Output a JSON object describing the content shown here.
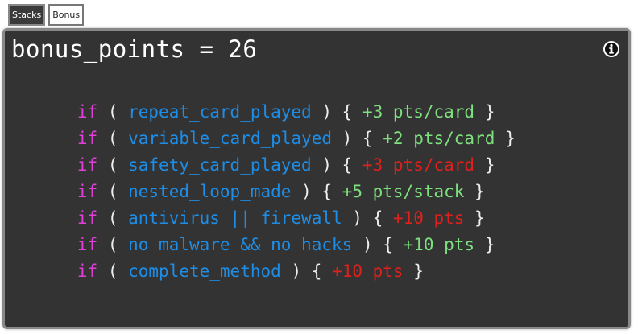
{
  "tabs": [
    {
      "label": "Stacks",
      "active": true
    },
    {
      "label": "Bonus",
      "active": false
    }
  ],
  "panel": {
    "title": "bonus_points = 26",
    "info_icon": "info-circle-icon"
  },
  "rules": [
    {
      "keyword": "if",
      "open": "(",
      "condition": "repeat_card_played",
      "close": ")",
      "brace_open": "{",
      "points": "+3 pts/card",
      "brace_close": "}",
      "color": "#7ee07e"
    },
    {
      "keyword": "if",
      "open": "(",
      "condition": "variable_card_played",
      "close": ")",
      "brace_open": "{",
      "points": "+2 pts/card",
      "brace_close": "}",
      "color": "#7ee07e"
    },
    {
      "keyword": "if",
      "open": "(",
      "condition": "safety_card_played",
      "close": ")",
      "brace_open": "{",
      "points": "+3 pts/card",
      "brace_close": "}",
      "color": "#e0201c"
    },
    {
      "keyword": "if",
      "open": "(",
      "condition": "nested_loop_made",
      "close": ")",
      "brace_open": "{",
      "points": "+5 pts/stack",
      "brace_close": "}",
      "color": "#7ee07e"
    },
    {
      "keyword": "if",
      "open": "(",
      "condition": "antivirus || firewall",
      "close": ")",
      "brace_open": "{",
      "points": "+10 pts",
      "brace_close": "}",
      "color": "#e0201c"
    },
    {
      "keyword": "if",
      "open": "(",
      "condition": "no_malware && no_hacks",
      "close": ")",
      "brace_open": "{",
      "points": "+10 pts",
      "brace_close": "}",
      "color": "#7ee07e"
    },
    {
      "keyword": "if",
      "open": "(",
      "condition": "complete_method",
      "close": ")",
      "brace_open": "{",
      "points": "+10 pts",
      "brace_close": "}",
      "color": "#e0201c"
    }
  ]
}
